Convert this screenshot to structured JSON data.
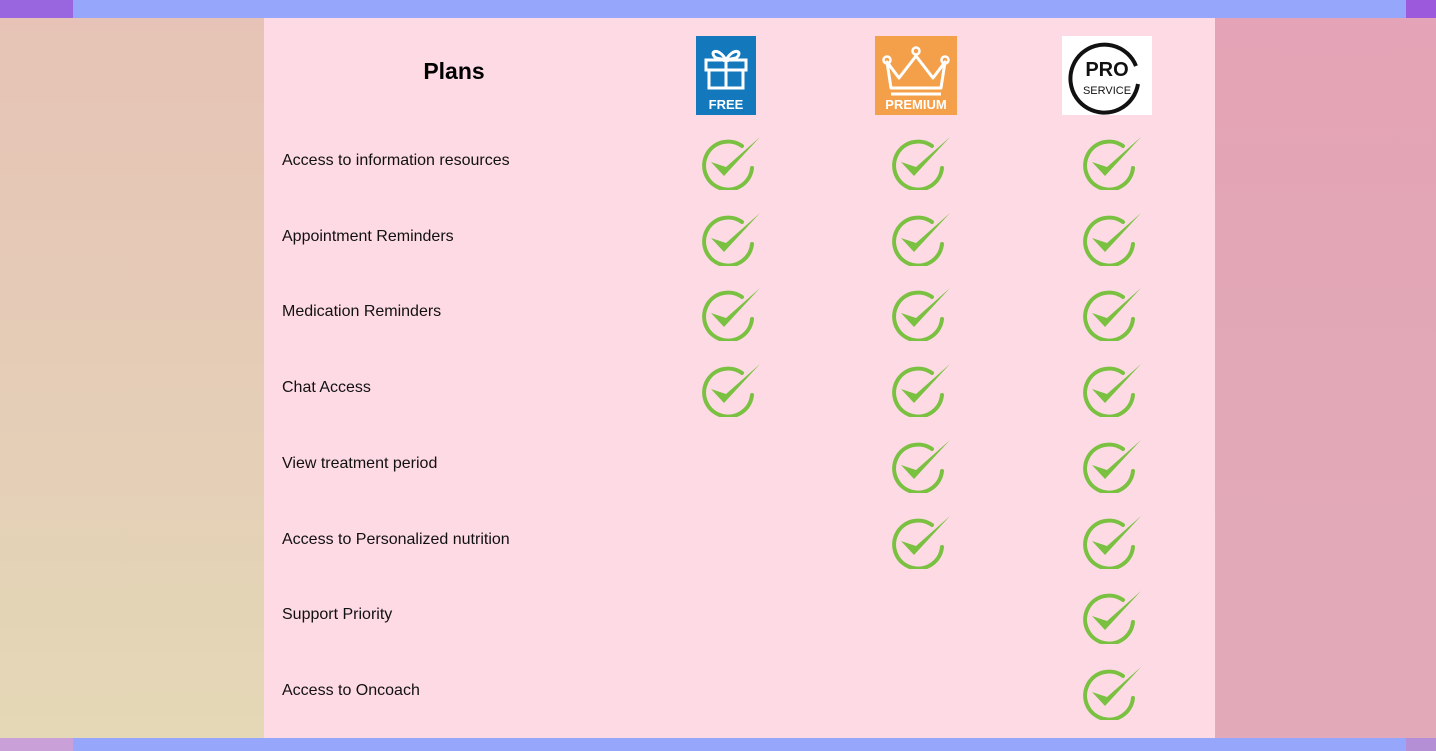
{
  "header": {
    "title": "Plans"
  },
  "plans": [
    {
      "label": "FREE",
      "icon": "gift-icon",
      "color": "#1478bd"
    },
    {
      "label": "PREMIUM",
      "icon": "crown-icon",
      "color": "#f4a04a"
    },
    {
      "label_top": "PRO",
      "label_bottom": "SERVICE",
      "icon": "pro-service-badge-icon",
      "color": "#ffffff"
    }
  ],
  "features": [
    {
      "label": "Access to information resources",
      "checks": [
        true,
        true,
        true
      ]
    },
    {
      "label": "Appointment Reminders",
      "checks": [
        true,
        true,
        true
      ]
    },
    {
      "label": "Medication Reminders",
      "checks": [
        true,
        true,
        true
      ]
    },
    {
      "label": "Chat Access",
      "checks": [
        true,
        true,
        true
      ]
    },
    {
      "label": "View treatment period",
      "checks": [
        false,
        true,
        true
      ]
    },
    {
      "label": "Access to Personalized nutrition",
      "checks": [
        false,
        true,
        true
      ]
    },
    {
      "label": "Support Priority",
      "checks": [
        false,
        false,
        true
      ]
    },
    {
      "label": "Access to Oncoach",
      "checks": [
        false,
        false,
        true
      ]
    }
  ],
  "colors": {
    "panel": "#fedae4",
    "check": "#7ac142",
    "top_bar": "#96a6fb"
  }
}
